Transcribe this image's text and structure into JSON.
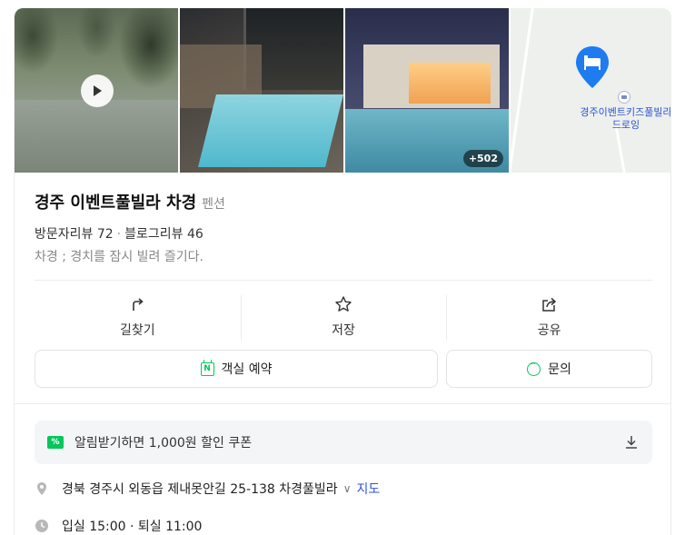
{
  "photos": {
    "more_count": "+502"
  },
  "map": {
    "place_label": "경주이벤트키즈풀빌라\n드로잉"
  },
  "place": {
    "name": "경주 이벤트풀빌라 차경",
    "category": "펜션",
    "visitor_reviews": "방문자리뷰 72",
    "blog_reviews": "블로그리뷰 46",
    "tagline": "차경 ; 경치를 잠시 빌려 즐기다."
  },
  "actions": {
    "directions": "길찾기",
    "save": "저장",
    "share": "공유"
  },
  "buttons": {
    "reserve": "객실 예약",
    "inquiry": "문의"
  },
  "coupon": {
    "icon_text": "%",
    "text": "알림받기하면 1,000원 할인 쿠폰"
  },
  "info": {
    "address": "경북 경주시 외동읍 제내못안길 25-138 차경풀빌라",
    "map_link": "지도",
    "hours": "입실 15:00 · 퇴실 11:00"
  },
  "colors": {
    "brand_green": "#03c75a",
    "link_blue": "#2d54d6",
    "pin_blue": "#1e7bf0"
  }
}
